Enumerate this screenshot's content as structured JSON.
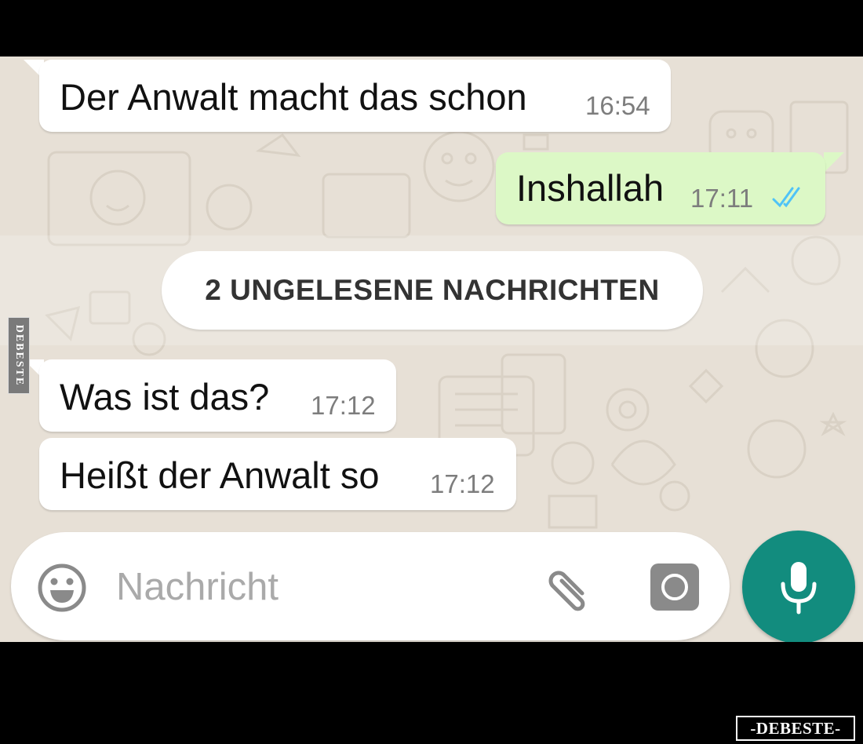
{
  "messages": [
    {
      "text": "Der Anwalt macht das schon",
      "time": "16:54",
      "direction": "incoming"
    },
    {
      "text": "Inshallah",
      "time": "17:11",
      "direction": "outgoing",
      "status_icon": "double-check-read-icon",
      "status_color": "#4fc3f7"
    },
    {
      "text": "Was ist das?",
      "time": "17:12",
      "direction": "incoming"
    },
    {
      "text": "Heißt der Anwalt so",
      "time": "17:12",
      "direction": "incoming"
    }
  ],
  "unread_banner": "2 UNGELESENE NACHRICHTEN",
  "input": {
    "placeholder": "Nachricht",
    "icons": [
      "emoji-icon",
      "paperclip-icon",
      "camera-icon",
      "microphone-icon"
    ]
  },
  "watermark": {
    "side": "DEBESTE",
    "bottom": "-DEBESTE-"
  },
  "colors": {
    "chat_background": "#e7e0d6",
    "incoming_bubble": "#ffffff",
    "outgoing_bubble": "#dcf8c6",
    "accent": "#128c7e",
    "read_ticks": "#4fc3f7"
  }
}
